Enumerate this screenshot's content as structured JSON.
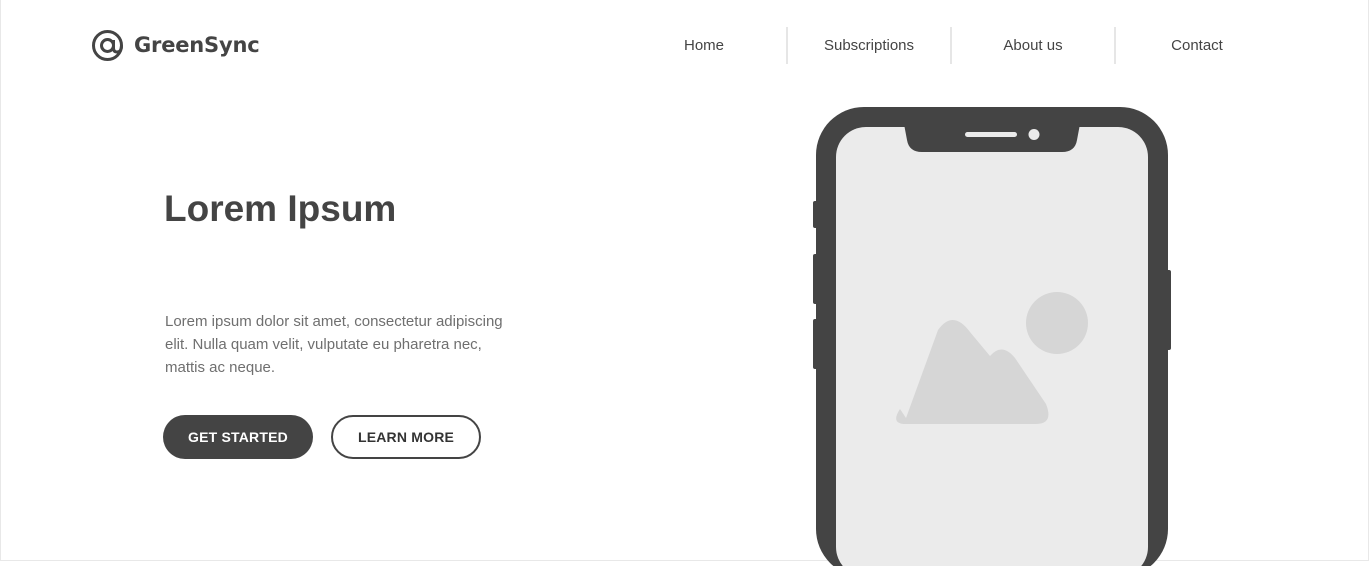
{
  "brand": {
    "logo_icon": "at-sign-icon",
    "name": "GreenSync"
  },
  "nav": {
    "items": [
      {
        "label": "Home"
      },
      {
        "label": "Subscriptions"
      },
      {
        "label": "About us"
      },
      {
        "label": "Contact"
      }
    ]
  },
  "hero": {
    "title": "Lorem Ipsum",
    "text": "Lorem ipsum dolor sit amet, consectetur adipiscing elit. Nulla quam velit, vulputate eu pharetra nec, mattis ac neque.",
    "primary_button": "GET STARTED",
    "secondary_button": "LEARN MORE"
  },
  "illustration": {
    "device": "smartphone-mockup",
    "screen_icon": "image-placeholder-icon"
  },
  "colors": {
    "primary": "#444444",
    "text_muted": "#6f6f6f",
    "screen": "#ebebeb",
    "placeholder": "#d6d6d6",
    "background": "#ffffff"
  }
}
